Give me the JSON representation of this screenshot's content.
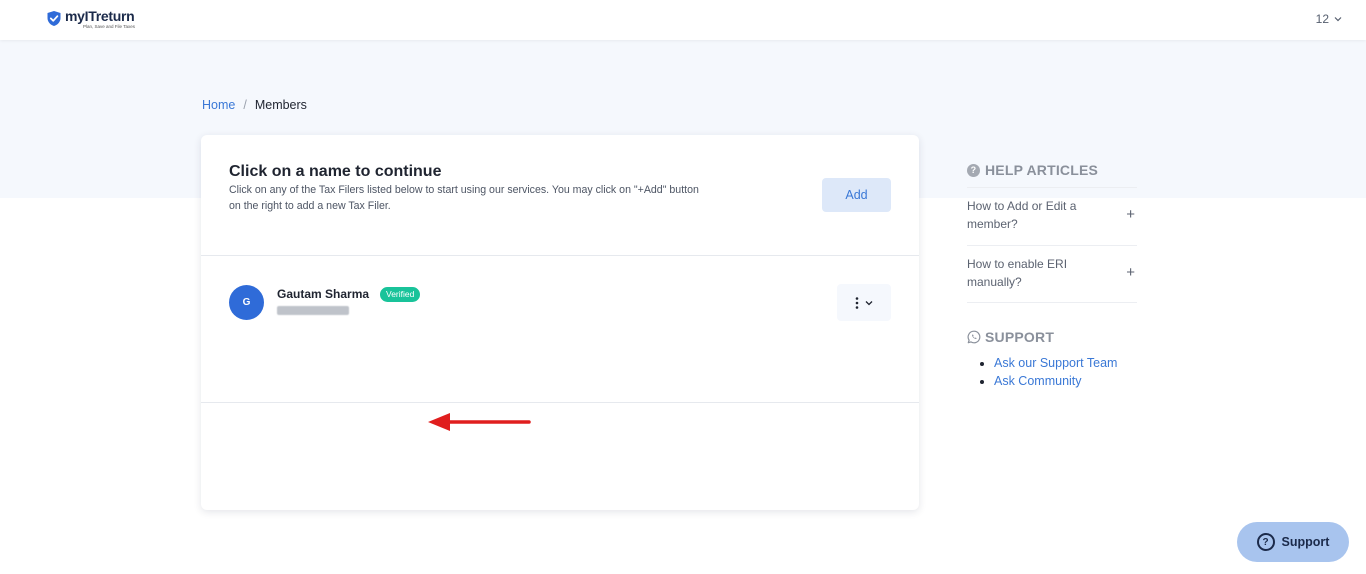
{
  "header": {
    "logo_name": "myITreturn",
    "logo_tagline": "Plan, Save and File Taxes",
    "user_label": "12"
  },
  "breadcrumb": {
    "home": "Home",
    "separator": "/",
    "current": "Members"
  },
  "card": {
    "title": "Click on a name to continue",
    "description": "Click on any of the Tax Filers listed below to start using our services. You may click on \"+Add\" button on the right to add a new Tax Filer.",
    "add_label": "Add"
  },
  "members": [
    {
      "initial": "G",
      "name": "Gautam Sharma",
      "status": "Verified"
    }
  ],
  "help": {
    "title": "HELP ARTICLES",
    "articles": [
      {
        "label": "How to Add or Edit a member?"
      },
      {
        "label": "How to enable ERI manually?"
      }
    ]
  },
  "support": {
    "title": "SUPPORT",
    "links": [
      {
        "label": "Ask our Support Team"
      },
      {
        "label": "Ask Community"
      }
    ],
    "fab_label": "Support"
  },
  "colors": {
    "primary": "#3a78d6",
    "avatar": "#2f6bd8",
    "verified": "#19c39a",
    "annotation_arrow": "#e01e1e",
    "hero_bg": "#f5f8fd"
  }
}
